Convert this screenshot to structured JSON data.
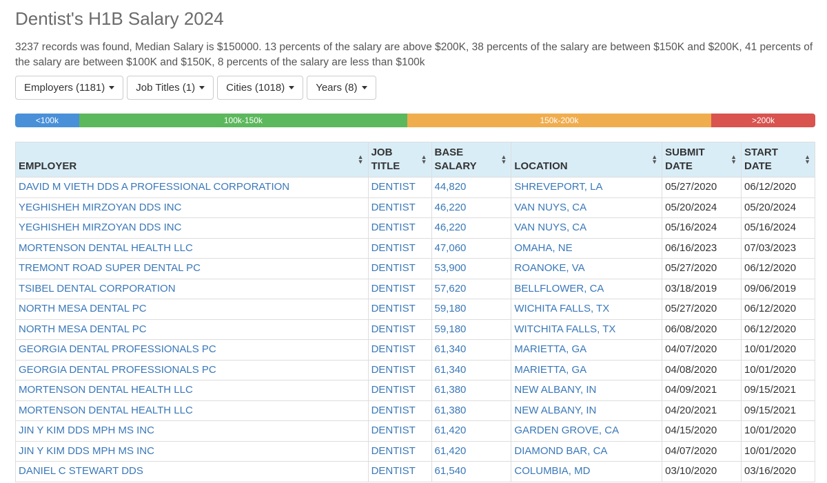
{
  "page": {
    "title": "Dentist's H1B Salary 2024",
    "summary": "3237 records was found, Median Salary is $150000. 13 percents of the salary are above $200K, 38 percents of the salary are between $150K and $200K, 41 percents of the salary are between $100K and $150K, 8 percents of the salary are less than $100k"
  },
  "filters": [
    {
      "label": "Employers (1181)"
    },
    {
      "label": "Job Titles (1)"
    },
    {
      "label": "Cities (1018)"
    },
    {
      "label": "Years (8)"
    }
  ],
  "ranges": [
    {
      "label": "<100k",
      "percent": 8,
      "color": "#4a90d9"
    },
    {
      "label": "100k-150k",
      "percent": 41,
      "color": "#5cb85c"
    },
    {
      "label": "150k-200k",
      "percent": 38,
      "color": "#f0ad4e"
    },
    {
      "label": ">200k",
      "percent": 13,
      "color": "#d9534f"
    }
  ],
  "table": {
    "headers": {
      "employer": "EMPLOYER",
      "job_title": "JOB TITLE",
      "base_salary": "BASE SALARY",
      "location": "LOCATION",
      "submit_date": "SUBMIT DATE",
      "start_date": "START DATE"
    },
    "rows": [
      {
        "employer": "DAVID M VIETH DDS A PROFESSIONAL CORPORATION",
        "job_title": "DENTIST",
        "salary": "44,820",
        "location": "SHREVEPORT, LA",
        "submit": "05/27/2020",
        "start": "06/12/2020"
      },
      {
        "employer": "YEGHISHEH MIRZOYAN DDS INC",
        "job_title": "DENTIST",
        "salary": "46,220",
        "location": "VAN NUYS, CA",
        "submit": "05/20/2024",
        "start": "05/20/2024"
      },
      {
        "employer": "YEGHISHEH MIRZOYAN DDS INC",
        "job_title": "DENTIST",
        "salary": "46,220",
        "location": "VAN NUYS, CA",
        "submit": "05/16/2024",
        "start": "05/16/2024"
      },
      {
        "employer": "MORTENSON DENTAL HEALTH LLC",
        "job_title": "DENTIST",
        "salary": "47,060",
        "location": "OMAHA, NE",
        "submit": "06/16/2023",
        "start": "07/03/2023"
      },
      {
        "employer": "TREMONT ROAD SUPER DENTAL PC",
        "job_title": "DENTIST",
        "salary": "53,900",
        "location": "ROANOKE, VA",
        "submit": "05/27/2020",
        "start": "06/12/2020"
      },
      {
        "employer": "TSIBEL DENTAL CORPORATION",
        "job_title": "DENTIST",
        "salary": "57,620",
        "location": "BELLFLOWER, CA",
        "submit": "03/18/2019",
        "start": "09/06/2019"
      },
      {
        "employer": "NORTH MESA DENTAL PC",
        "job_title": "DENTIST",
        "salary": "59,180",
        "location": "WICHITA FALLS, TX",
        "submit": "05/27/2020",
        "start": "06/12/2020"
      },
      {
        "employer": "NORTH MESA DENTAL PC",
        "job_title": "DENTIST",
        "salary": "59,180",
        "location": "WITCHITA FALLS, TX",
        "submit": "06/08/2020",
        "start": "06/12/2020"
      },
      {
        "employer": "GEORGIA DENTAL PROFESSIONALS PC",
        "job_title": "DENTIST",
        "salary": "61,340",
        "location": "MARIETTA, GA",
        "submit": "04/07/2020",
        "start": "10/01/2020"
      },
      {
        "employer": "GEORGIA DENTAL PROFESSIONALS PC",
        "job_title": "DENTIST",
        "salary": "61,340",
        "location": "MARIETTA, GA",
        "submit": "04/08/2020",
        "start": "10/01/2020"
      },
      {
        "employer": "MORTENSON DENTAL HEALTH LLC",
        "job_title": "DENTIST",
        "salary": "61,380",
        "location": "NEW ALBANY, IN",
        "submit": "04/09/2021",
        "start": "09/15/2021"
      },
      {
        "employer": "MORTENSON DENTAL HEALTH LLC",
        "job_title": "DENTIST",
        "salary": "61,380",
        "location": "NEW ALBANY, IN",
        "submit": "04/20/2021",
        "start": "09/15/2021"
      },
      {
        "employer": "JIN Y KIM DDS MPH MS INC",
        "job_title": "DENTIST",
        "salary": "61,420",
        "location": "GARDEN GROVE, CA",
        "submit": "04/15/2020",
        "start": "10/01/2020"
      },
      {
        "employer": "JIN Y KIM DDS MPH MS INC",
        "job_title": "DENTIST",
        "salary": "61,420",
        "location": "DIAMOND BAR, CA",
        "submit": "04/07/2020",
        "start": "10/01/2020"
      },
      {
        "employer": "DANIEL C STEWART DDS",
        "job_title": "DENTIST",
        "salary": "61,540",
        "location": "COLUMBIA, MD",
        "submit": "03/10/2020",
        "start": "03/16/2020"
      }
    ]
  }
}
